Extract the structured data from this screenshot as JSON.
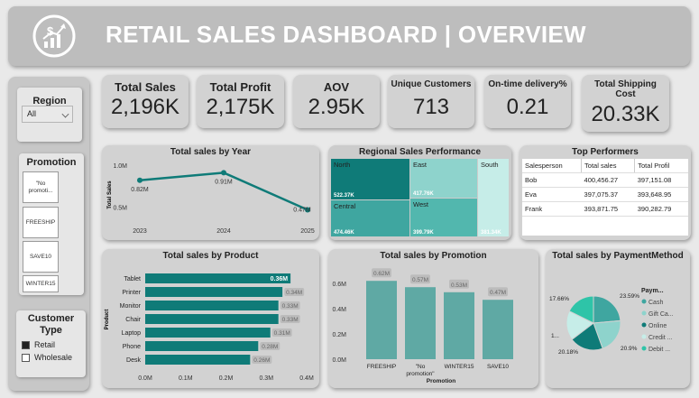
{
  "header": {
    "title": "RETAIL SALES DASHBOARD | OVERVIEW",
    "logo_icon": "dollar-growth-icon"
  },
  "kpis": [
    {
      "label": "Total Sales",
      "value": "2,196K"
    },
    {
      "label": "Total Profit",
      "value": "2,175K"
    },
    {
      "label": "AOV",
      "value": "2.95K"
    },
    {
      "label": "Unique Customers",
      "value": "713"
    },
    {
      "label": "On-time delivery%",
      "value": "0.21"
    },
    {
      "label": "Total Shipping Cost",
      "value": "20.33K"
    }
  ],
  "filters": {
    "region": {
      "label": "Region",
      "selected": "All"
    },
    "promotion": {
      "label": "Promotion",
      "options": [
        "\"No promoti...",
        "FREESHIP",
        "SAVE10",
        "WINTER15"
      ]
    },
    "customer_type": {
      "label": "Customer Type",
      "options": [
        {
          "label": "Retail",
          "checked": true
        },
        {
          "label": "Wholesale",
          "checked": false
        }
      ]
    }
  },
  "colors": {
    "teal": "#0f7b78",
    "teal_mid": "#3fa6a0",
    "teal_light": "#8ed3cc",
    "teal_pale": "#c6ede8",
    "card": "#d2d2d2"
  },
  "year_chart": {
    "title": "Total sales by Year",
    "ylabel": "Total Sales",
    "yticks": [
      "1.0M",
      "0.5M"
    ],
    "chart_data": {
      "type": "line",
      "x": [
        "2023",
        "2024",
        "2025"
      ],
      "values": [
        0.82,
        0.91,
        0.47
      ],
      "labels": [
        "0.82M",
        "0.91M",
        "0.47M"
      ],
      "ylim": [
        0.4,
        1.0
      ]
    }
  },
  "regional": {
    "title": "Regional Sales Performance",
    "chart_data": {
      "type": "treemap",
      "regions": [
        {
          "name": "North",
          "value": "522.37K"
        },
        {
          "name": "East",
          "value": "417.76K"
        },
        {
          "name": "South",
          "value": "381.34K"
        },
        {
          "name": "Central",
          "value": "474.46K"
        },
        {
          "name": "West",
          "value": "399.79K"
        }
      ]
    }
  },
  "top_performers": {
    "title": "Top Performers",
    "columns": [
      "Salesperson",
      "Total sales",
      "Total Profil"
    ],
    "rows": [
      [
        "Bob",
        "400,456.27",
        "397,151.08"
      ],
      [
        "Eva",
        "397,075.37",
        "393,648.95"
      ],
      [
        "Frank",
        "393,871.75",
        "390,282.79"
      ]
    ]
  },
  "product_chart": {
    "title": "Total sales by Product",
    "ylabel": "Product",
    "xticks": [
      "0.0M",
      "0.1M",
      "0.2M",
      "0.3M",
      "0.4M"
    ],
    "chart_data": {
      "type": "bar",
      "categories": [
        "Tablet",
        "Printer",
        "Monitor",
        "Chair",
        "Laptop",
        "Phone",
        "Desk"
      ],
      "values": [
        0.36,
        0.34,
        0.33,
        0.33,
        0.31,
        0.28,
        0.26
      ],
      "labels": [
        "0.36M",
        "0.34M",
        "0.33M",
        "0.33M",
        "0.31M",
        "0.28M",
        "0.26M"
      ],
      "xlim": [
        0,
        0.4
      ]
    }
  },
  "promotion_chart": {
    "title": "Total sales by Promotion",
    "xlabel": "Promotion",
    "yticks": [
      "0.6M",
      "0.4M",
      "0.2M",
      "0.0M"
    ],
    "chart_data": {
      "type": "bar",
      "categories": [
        "FREESHIP",
        "\"No promotion\"",
        "WINTER15",
        "SAVE10"
      ],
      "values": [
        0.62,
        0.57,
        0.53,
        0.47
      ],
      "labels": [
        "0.62M",
        "0.57M",
        "0.53M",
        "0.47M"
      ],
      "ylim": [
        0,
        0.7
      ]
    }
  },
  "payment_chart": {
    "title": "Total sales by PaymentMethod",
    "legend_title": "Paym...",
    "chart_data": {
      "type": "pie",
      "slices": [
        {
          "name": "Cash",
          "percent": 23.59,
          "label": "23.59%",
          "color": "#3fa6a0"
        },
        {
          "name": "Gift Ca...",
          "percent": 20.9,
          "label": "20.9%",
          "color": "#8ed3cc"
        },
        {
          "name": "Online",
          "percent": 20.18,
          "label": "20.18%",
          "color": "#0f7b78"
        },
        {
          "name": "Credit ...",
          "percent": 17.66,
          "label": "1...",
          "color": "#c6ede8"
        },
        {
          "name": "Debit ...",
          "percent": 17.66,
          "label": "17.66%",
          "color": "#2ec4a8"
        }
      ]
    }
  }
}
